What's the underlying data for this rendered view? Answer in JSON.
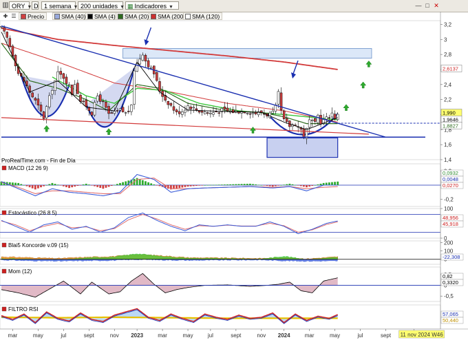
{
  "toolbar": {
    "symbol": "ORY",
    "period_badge": "D",
    "timeframe": "1 semana",
    "units": "200 unidades",
    "indicators_label": "Indicadores",
    "colors": {
      "bg": "#ece9e2",
      "accent": "#2e7d32"
    }
  },
  "legend": {
    "items": [
      {
        "label": "Precio",
        "color": "#d04040"
      },
      {
        "label": "SMA (40)",
        "color": "#9ad"
      },
      {
        "label": "SMA (4)",
        "color": "#000000"
      },
      {
        "label": "SMA (20)",
        "color": "#2e6b1e"
      },
      {
        "label": "SMA (200)",
        "color": "#cc3030"
      },
      {
        "label": "SMA (120)",
        "color": "#ffffff"
      }
    ]
  },
  "source": "ProRealTime.com - Fin de Día",
  "price_badges": {
    "current": "1,990",
    "sma4": "1,9646",
    "sma20": "1,8827",
    "sma200": "2,6137"
  },
  "chart_data": [
    {
      "type": "candlestick",
      "panel": "price",
      "yticks": [
        "3,2",
        "3",
        "2,8",
        "2,6",
        "2,4",
        "2,2",
        "2",
        "1,8",
        "1,6",
        "1,4"
      ],
      "ylim": [
        1.4,
        3.25
      ],
      "x_ticks": [
        "mar",
        "may",
        "jul",
        "sept",
        "nov",
        "2023",
        "mar",
        "may",
        "jul",
        "sept",
        "nov",
        "2024",
        "mar",
        "may",
        "jul",
        "sept",
        "11 nov 2024 W46"
      ],
      "x_range_weeks": 150,
      "tick_weeks": [
        4,
        13,
        22,
        31,
        40,
        48,
        57,
        66,
        74,
        83,
        92,
        100,
        109,
        118,
        127,
        136,
        146
      ],
      "ohlc_anchor_weeks": [
        0,
        2,
        4,
        6,
        8,
        10,
        12,
        15,
        16,
        18,
        20,
        22,
        24,
        25,
        26,
        28,
        30,
        32,
        34,
        36,
        38,
        40,
        42,
        44,
        46,
        47,
        49,
        50,
        51,
        54,
        56,
        58,
        60,
        62,
        64,
        66,
        70,
        74,
        78,
        82,
        86,
        90,
        92,
        94,
        96,
        97,
        98,
        99,
        100,
        102,
        104,
        106,
        107,
        108,
        109,
        111,
        112,
        113,
        115,
        117,
        118,
        119
      ],
      "close_anchor_values": [
        3.15,
        3.02,
        2.8,
        2.55,
        2.45,
        2.3,
        2.18,
        1.96,
        2.1,
        2.35,
        2.55,
        2.5,
        2.38,
        2.28,
        2.42,
        2.18,
        2.12,
        2.02,
        2.25,
        2.15,
        2.0,
        2.02,
        2.06,
        2.02,
        2.1,
        2.6,
        2.75,
        2.82,
        2.72,
        2.55,
        2.32,
        2.2,
        2.12,
        2.02,
        2.05,
        2.12,
        2.05,
        2.02,
        2.06,
        2.04,
        2.05,
        2.02,
        2.03,
        2.0,
        2.02,
        2.1,
        2.28,
        2.05,
        1.92,
        1.85,
        1.88,
        1.8,
        1.72,
        1.8,
        1.92,
        1.88,
        1.99,
        1.9,
        1.95,
        2.02,
        1.96,
        1.99
      ],
      "sma4": {
        "weeks": [
          0,
          10,
          20,
          30,
          40,
          48,
          56,
          66,
          80,
          92,
          100,
          108,
          119
        ],
        "values": [
          3.1,
          2.3,
          2.45,
          2.1,
          2.05,
          2.7,
          2.3,
          2.06,
          2.04,
          2.03,
          1.9,
          1.8,
          1.96
        ]
      },
      "sma20": {
        "weeks": [
          0,
          10,
          20,
          30,
          38,
          48,
          56,
          66,
          80,
          92,
          100,
          108,
          119
        ],
        "values": [
          2.95,
          2.45,
          2.35,
          2.2,
          2.05,
          2.4,
          2.35,
          2.15,
          2.05,
          2.03,
          1.97,
          1.88,
          1.88
        ]
      },
      "sma40": {
        "weeks": [
          18,
          30,
          40,
          48,
          58,
          70,
          84,
          100,
          119
        ],
        "values": [
          2.5,
          2.25,
          2.15,
          2.35,
          2.32,
          2.15,
          2.05,
          2.0,
          1.93
        ]
      },
      "sma200": {
        "weeks": [
          0,
          20,
          40,
          60,
          80,
          100,
          119
        ],
        "values": [
          3.15,
          3.0,
          2.92,
          2.85,
          2.78,
          2.7,
          2.6
        ]
      },
      "sma120": {
        "weeks": [
          0,
          20,
          40,
          60,
          80,
          100,
          119
        ],
        "values": [
          2.95,
          2.7,
          2.42,
          2.3,
          2.15,
          2.05,
          1.9
        ]
      },
      "annotations": {
        "downtrend_line": [
          [
            0,
            3.18
          ],
          [
            136,
            1.7
          ]
        ],
        "support_line": [
          [
            0,
            1.96
          ],
          [
            130,
            1.74
          ]
        ],
        "support_floor": [
          [
            0,
            1.7
          ],
          [
            150,
            1.7
          ]
        ],
        "resistance_box": [
          [
            43,
            2.88
          ],
          [
            131,
            2.75
          ]
        ],
        "bottom_box": [
          [
            94,
            1.69
          ],
          [
            119,
            1.43
          ]
        ],
        "cup_arcs": [
          {
            "from": 7,
            "to": 24,
            "depth": 1.98
          },
          {
            "from": 30,
            "to": 47,
            "depth": 1.95
          },
          {
            "from": 94,
            "to": 119,
            "depth": 1.72
          }
        ],
        "up_arrows": [
          [
            16,
            1.8
          ],
          [
            38,
            1.76
          ],
          [
            89,
            1.78
          ],
          [
            122,
            2.08
          ],
          [
            128,
            2.38
          ],
          [
            130,
            2.66
          ]
        ],
        "down_arrows": [
          [
            51,
            2.92
          ],
          [
            103,
            2.48
          ]
        ]
      }
    },
    {
      "type": "bar+line",
      "panel": "MACD",
      "title": "MACD (12 26 9)",
      "yticks": [
        "0,2",
        "0",
        "-0,2"
      ],
      "ylim": [
        -0.3,
        0.3
      ],
      "value_badges": [
        "0,0932",
        "0,0048",
        "0,0270"
      ],
      "hist": {
        "weeks": [
          0,
          6,
          12,
          18,
          24,
          30,
          36,
          42,
          48,
          54,
          60,
          66,
          72,
          80,
          88,
          96,
          102,
          108,
          114,
          119
        ],
        "values": [
          0.05,
          0.03,
          -0.06,
          0.03,
          -0.04,
          0.02,
          -0.05,
          0.03,
          0.1,
          0.01,
          -0.06,
          -0.02,
          0.0,
          0.01,
          0.02,
          -0.02,
          0.02,
          -0.03,
          0.03,
          0.05
        ]
      },
      "macd": {
        "weeks": [
          0,
          6,
          12,
          18,
          24,
          30,
          36,
          42,
          48,
          54,
          60,
          66,
          72,
          80,
          88,
          96,
          102,
          108,
          114,
          119
        ],
        "values": [
          0.05,
          -0.05,
          -0.15,
          -0.05,
          -0.1,
          -0.12,
          -0.15,
          -0.1,
          0.15,
          0.08,
          -0.1,
          -0.05,
          -0.04,
          -0.03,
          -0.02,
          -0.04,
          -0.02,
          -0.08,
          0.0,
          0.0
        ]
      },
      "signal": {
        "weeks": [
          0,
          6,
          12,
          18,
          24,
          30,
          36,
          42,
          48,
          54,
          60,
          66,
          72,
          80,
          88,
          96,
          102,
          108,
          114,
          119
        ],
        "values": [
          0.04,
          -0.03,
          -0.12,
          -0.08,
          -0.08,
          -0.1,
          -0.12,
          -0.12,
          0.08,
          0.1,
          -0.05,
          -0.05,
          -0.04,
          -0.03,
          -0.02,
          -0.03,
          -0.02,
          -0.05,
          -0.03,
          -0.02
        ]
      }
    },
    {
      "type": "line",
      "panel": "Estocástico",
      "title": "Estocástico (26 8 5)",
      "yticks": [
        "100",
        "0"
      ],
      "ylim": [
        0,
        100
      ],
      "value_badges": [
        "48,956",
        "45,918"
      ],
      "k": {
        "weeks": [
          0,
          5,
          10,
          15,
          20,
          25,
          30,
          35,
          40,
          45,
          50,
          55,
          60,
          65,
          70,
          75,
          80,
          85,
          90,
          95,
          100,
          105,
          110,
          115,
          119
        ],
        "values": [
          60,
          40,
          20,
          45,
          55,
          30,
          40,
          20,
          35,
          70,
          85,
          60,
          40,
          25,
          45,
          40,
          45,
          40,
          40,
          55,
          40,
          15,
          30,
          50,
          58
        ]
      },
      "d": {
        "weeks": [
          0,
          5,
          10,
          15,
          20,
          25,
          30,
          35,
          40,
          45,
          50,
          55,
          60,
          65,
          70,
          75,
          80,
          85,
          90,
          95,
          100,
          105,
          110,
          115,
          119
        ],
        "values": [
          58,
          45,
          25,
          40,
          50,
          35,
          38,
          25,
          32,
          62,
          80,
          65,
          45,
          30,
          42,
          40,
          44,
          41,
          41,
          50,
          42,
          20,
          28,
          46,
          55
        ]
      }
    },
    {
      "type": "area",
      "panel": "Blai5",
      "title": "Blai5 Koncorde v.09 (15)",
      "yticks": [
        "200",
        "100",
        "0"
      ],
      "ylim": [
        -60,
        220
      ],
      "value_badges": [
        "-22,308"
      ],
      "orange": {
        "weeks": [
          0,
          10,
          20,
          30,
          40,
          48,
          56,
          66,
          80,
          92,
          100,
          108,
          119
        ],
        "values": [
          30,
          20,
          10,
          25,
          35,
          60,
          45,
          20,
          15,
          10,
          25,
          5,
          30
        ]
      },
      "green": {
        "weeks": [
          0,
          10,
          20,
          30,
          40,
          48,
          56,
          66,
          80,
          92,
          100,
          108,
          119
        ],
        "values": [
          10,
          5,
          -10,
          20,
          30,
          70,
          40,
          15,
          10,
          5,
          40,
          0,
          25
        ]
      },
      "blue": {
        "weeks": [
          0,
          10,
          20,
          30,
          40,
          48,
          56,
          66,
          80,
          92,
          100,
          108,
          119
        ],
        "values": [
          -10,
          -20,
          -25,
          -20,
          -15,
          -5,
          -10,
          -15,
          -12,
          -10,
          -20,
          -25,
          -22
        ]
      }
    },
    {
      "type": "area",
      "panel": "Mom",
      "title": "Mom (12)",
      "yticks": [
        "0,5",
        "0",
        "-0,5"
      ],
      "ylim": [
        -0.75,
        0.85
      ],
      "value_badges": [
        "0,82",
        "0,3320"
      ],
      "values": {
        "weeks": [
          0,
          6,
          12,
          18,
          22,
          28,
          32,
          38,
          42,
          46,
          50,
          54,
          58,
          62,
          66,
          72,
          80,
          88,
          94,
          98,
          102,
          106,
          110,
          114,
          119
        ],
        "values": [
          -0.2,
          -0.35,
          -0.55,
          -0.1,
          0.2,
          -0.4,
          0.15,
          -0.4,
          -0.3,
          0.2,
          0.55,
          0.05,
          -0.35,
          -0.2,
          -0.1,
          0.0,
          0.02,
          -0.05,
          0.0,
          0.05,
          0.15,
          -0.25,
          -0.35,
          0.2,
          0.35
        ]
      }
    },
    {
      "type": "area",
      "panel": "FILTRO RSI",
      "title": "FILTRO RSI",
      "value_badges": [
        "57,065",
        "50,440"
      ],
      "ylim": [
        30,
        75
      ],
      "rsi": {
        "weeks": [
          0,
          4,
          8,
          12,
          16,
          20,
          24,
          28,
          32,
          36,
          40,
          44,
          48,
          52,
          56,
          60,
          64,
          68,
          72,
          76,
          80,
          84,
          88,
          92,
          96,
          100,
          104,
          108,
          112,
          116,
          119
        ],
        "values": [
          55,
          48,
          58,
          42,
          62,
          50,
          45,
          60,
          48,
          44,
          56,
          62,
          68,
          52,
          46,
          58,
          50,
          44,
          58,
          52,
          48,
          56,
          50,
          52,
          60,
          42,
          58,
          46,
          54,
          50,
          57
        ]
      },
      "signal": {
        "weeks": [
          0,
          20,
          40,
          60,
          80,
          100,
          119
        ],
        "values": [
          52,
          51,
          52,
          51,
          50,
          50,
          50
        ]
      }
    }
  ]
}
